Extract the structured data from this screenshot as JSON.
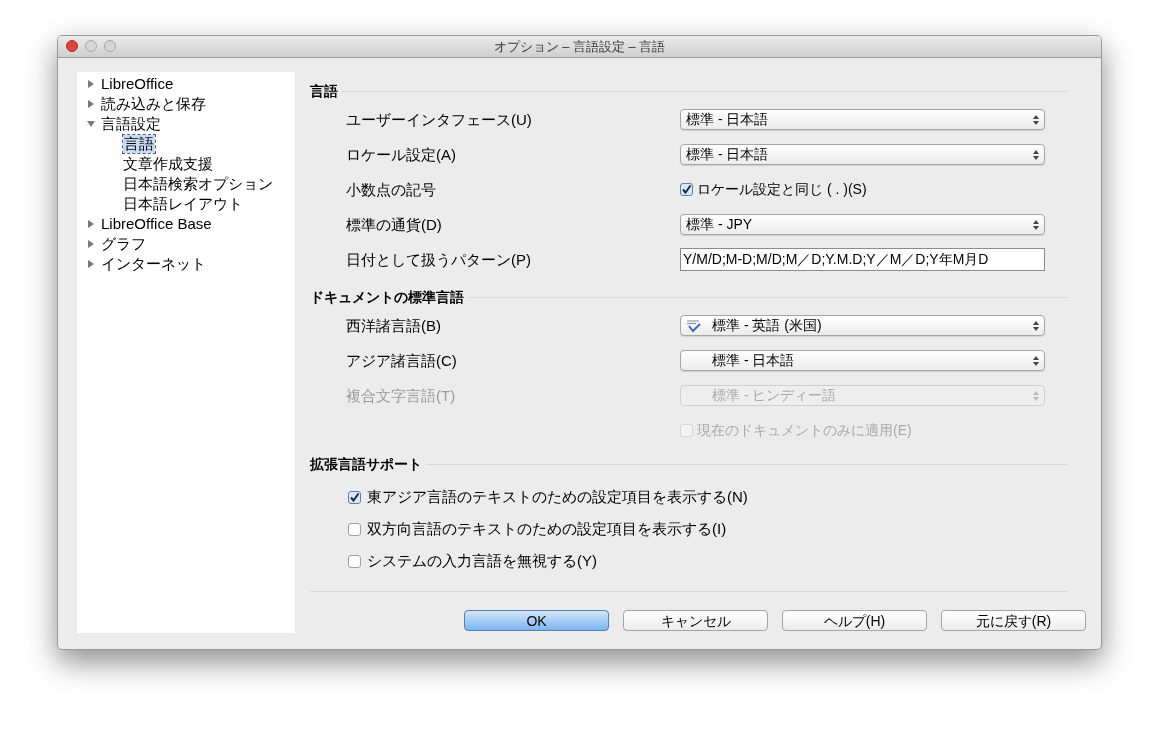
{
  "window": {
    "title": "オプション – 言語設定 – 言語"
  },
  "sidebar": {
    "items": [
      {
        "label": "LibreOffice",
        "expanded": false,
        "selected": false
      },
      {
        "label": "読み込みと保存",
        "expanded": false,
        "selected": false
      },
      {
        "label": "言語設定",
        "expanded": true,
        "selected": false,
        "children": [
          {
            "label": "言語",
            "selected": true
          },
          {
            "label": "文章作成支援",
            "selected": false
          },
          {
            "label": "日本語検索オプション",
            "selected": false
          },
          {
            "label": "日本語レイアウト",
            "selected": false
          }
        ]
      },
      {
        "label": "LibreOffice Base",
        "expanded": false,
        "selected": false
      },
      {
        "label": "グラフ",
        "expanded": false,
        "selected": false
      },
      {
        "label": "インターネット",
        "expanded": false,
        "selected": false
      }
    ]
  },
  "sections": [
    {
      "title": "言語",
      "rows": [
        {
          "label": "ユーザーインタフェース(U)",
          "disabled": false,
          "control": {
            "kind": "select",
            "value": "標準 - 日本語",
            "disabled": false
          }
        },
        {
          "label": "ロケール設定(A)",
          "disabled": false,
          "control": {
            "kind": "select",
            "value": "標準 - 日本語",
            "disabled": false
          }
        },
        {
          "label": "小数点の記号",
          "disabled": false,
          "control": {
            "kind": "checkbox",
            "label": "ロケール設定と同じ ( . )(S)",
            "checked": true,
            "disabled": false
          }
        },
        {
          "label": "標準の通貨(D)",
          "disabled": false,
          "control": {
            "kind": "select",
            "value": "標準 - JPY",
            "disabled": false
          }
        },
        {
          "label": "日付として扱うパターン(P)",
          "disabled": false,
          "control": {
            "kind": "text",
            "value": "Y/M/D;M-D;M/D;M／D;Y.M.D;Y／M／D;Y年M月D"
          }
        }
      ]
    },
    {
      "title": "ドキュメントの標準言語",
      "rows": [
        {
          "label": "西洋諸言語(B)",
          "disabled": false,
          "control": {
            "kind": "language_select",
            "value": "標準 - 英語 (米国)",
            "disabled": false,
            "spellcheck": true
          }
        },
        {
          "label": "アジア諸言語(C)",
          "disabled": false,
          "control": {
            "kind": "language_select",
            "value": "標準 - 日本語",
            "disabled": false,
            "spellcheck": false
          }
        },
        {
          "label": "複合文字言語(T)",
          "disabled": true,
          "control": {
            "kind": "language_select",
            "value": "標準 - ヒンディー語",
            "disabled": true,
            "spellcheck": false
          }
        },
        {
          "control": {
            "kind": "checkbox",
            "label": "現在のドキュメントのみに適用(E)",
            "checked": false,
            "disabled": true
          }
        }
      ]
    },
    {
      "title": "拡張言語サポート",
      "options": [
        {
          "label": "東アジア言語のテキストのための設定項目を表示する(N)",
          "checked": true
        },
        {
          "label": "双方向言語のテキストのための設定項目を表示する(I)",
          "checked": false
        },
        {
          "label": "システムの入力言語を無視する(Y)",
          "checked": false
        }
      ]
    }
  ],
  "buttons": [
    {
      "label": "OK",
      "default": true
    },
    {
      "label": "キャンセル",
      "default": false
    },
    {
      "label": "ヘルプ(H)",
      "default": false
    },
    {
      "label": "元に戻す(R)",
      "default": false
    }
  ]
}
